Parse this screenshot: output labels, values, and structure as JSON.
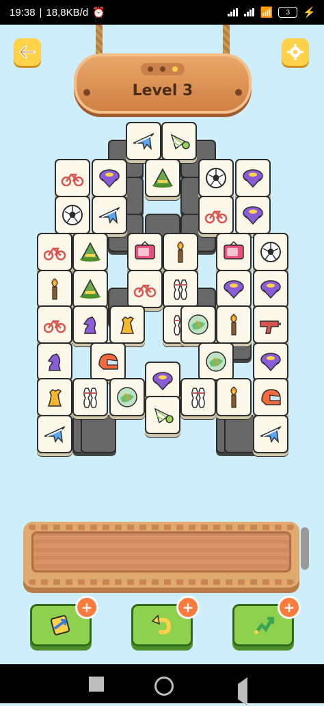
{
  "status": {
    "time": "19:38",
    "speed": "18,8KB/d",
    "battery": "3"
  },
  "level": {
    "title": "Level 3"
  },
  "icons": {
    "back": "back-arrow-icon",
    "settings": "gear-icon",
    "shuffle": "shuffle-icon",
    "undo": "undo-icon",
    "hint": "hint-icon"
  },
  "buttons": {
    "plus": "+"
  },
  "tiles": [
    {
      "name": "airplane",
      "icon": "airplane"
    },
    {
      "name": "shuttlecock",
      "icon": "shuttlecock"
    },
    {
      "name": "bicycle",
      "icon": "bicycle"
    },
    {
      "name": "spinning-top",
      "icon": "top"
    },
    {
      "name": "witch-hat",
      "icon": "hat"
    },
    {
      "name": "soccer-ball",
      "icon": "soccer"
    },
    {
      "name": "spinning-top",
      "icon": "top"
    },
    {
      "name": "soccer-ball",
      "icon": "soccer"
    },
    {
      "name": "airplane",
      "icon": "airplane"
    },
    {
      "name": "bicycle",
      "icon": "bicycle"
    },
    {
      "name": "spinning-top",
      "icon": "top"
    },
    {
      "name": "bicycle",
      "icon": "bicycle"
    },
    {
      "name": "witch-hat",
      "icon": "hat"
    },
    {
      "name": "television",
      "icon": "tv"
    },
    {
      "name": "torch",
      "icon": "torch"
    },
    {
      "name": "television",
      "icon": "tv"
    },
    {
      "name": "soccer-ball",
      "icon": "soccer"
    },
    {
      "name": "torch",
      "icon": "torch"
    },
    {
      "name": "witch-hat",
      "icon": "hat"
    },
    {
      "name": "bicycle",
      "icon": "bicycle"
    },
    {
      "name": "bowling",
      "icon": "bowling"
    },
    {
      "name": "spinning-top",
      "icon": "top"
    },
    {
      "name": "spinning-top",
      "icon": "top"
    },
    {
      "name": "bicycle",
      "icon": "bicycle"
    },
    {
      "name": "chess-knight",
      "icon": "knight"
    },
    {
      "name": "chess-rook",
      "icon": "rook"
    },
    {
      "name": "bowling",
      "icon": "bowling"
    },
    {
      "name": "marble",
      "icon": "marble"
    },
    {
      "name": "torch",
      "icon": "torch"
    },
    {
      "name": "toy-gun",
      "icon": "gun"
    },
    {
      "name": "chess-knight",
      "icon": "knight"
    },
    {
      "name": "helmet",
      "icon": "helmet"
    },
    {
      "name": "marble",
      "icon": "marble"
    },
    {
      "name": "spinning-top",
      "icon": "top"
    },
    {
      "name": "chess-rook",
      "icon": "rook"
    },
    {
      "name": "bowling",
      "icon": "bowling"
    },
    {
      "name": "marble",
      "icon": "marble"
    },
    {
      "name": "spinning-top",
      "icon": "top"
    },
    {
      "name": "bowling",
      "icon": "bowling"
    },
    {
      "name": "torch",
      "icon": "torch"
    },
    {
      "name": "helmet",
      "icon": "helmet"
    },
    {
      "name": "shuttlecock",
      "icon": "shuttlecock"
    },
    {
      "name": "airplane",
      "icon": "airplane"
    },
    {
      "name": "airplane",
      "icon": "airplane"
    }
  ]
}
